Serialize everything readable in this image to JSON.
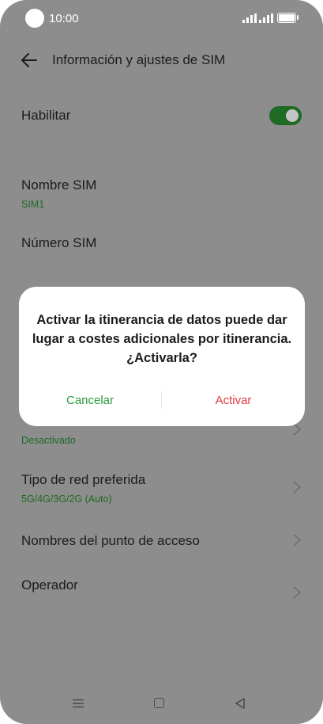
{
  "status_bar": {
    "time": "10:00"
  },
  "header": {
    "title": "Información y ajustes de SIM"
  },
  "settings": {
    "enable": {
      "label": "Habilitar",
      "on": true
    },
    "sim_name": {
      "label": "Nombre SIM",
      "value": "SIM1"
    },
    "sim_number": {
      "label": "Número SIM"
    },
    "roaming": {
      "value": "Desactivado"
    },
    "network_type": {
      "label": "Tipo de red preferida",
      "value": "5G/4G/3G/2G (Auto)"
    },
    "apn": {
      "label": "Nombres del punto de acceso"
    },
    "operator": {
      "label": "Operador"
    }
  },
  "dialog": {
    "message": "Activar la itinerancia de datos puede dar lugar a costes adicionales por itinerancia. ¿Activarla?",
    "cancel_label": "Cancelar",
    "confirm_label": "Activar"
  },
  "colors": {
    "accent_green": "#2e9a3b",
    "confirm_red": "#e03a45",
    "overlay_gray": "#8d8d8d"
  },
  "icons": {
    "back": "arrow-left-icon",
    "chevron": "chevron-right-icon",
    "nav": [
      "menu-icon",
      "home-icon",
      "back-triangle-icon"
    ]
  }
}
